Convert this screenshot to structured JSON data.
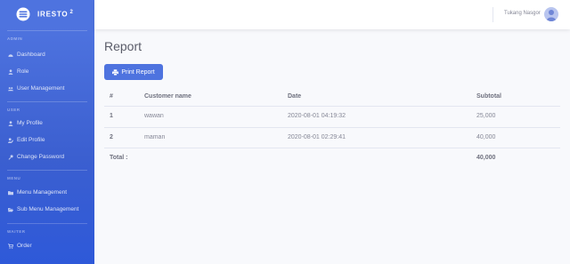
{
  "brand": {
    "name": "IRESTO",
    "sup": "2"
  },
  "sidebar": {
    "sections": [
      {
        "heading": "ADMIN",
        "items": [
          {
            "label": "Dashboard",
            "icon": "dashboard-icon"
          },
          {
            "label": "Role",
            "icon": "user-icon"
          },
          {
            "label": "User Management",
            "icon": "users-icon"
          }
        ]
      },
      {
        "heading": "USER",
        "items": [
          {
            "label": "My Profile",
            "icon": "user-icon"
          },
          {
            "label": "Edit Profile",
            "icon": "user-edit-icon"
          },
          {
            "label": "Change Password",
            "icon": "key-icon"
          }
        ]
      },
      {
        "heading": "MENU",
        "items": [
          {
            "label": "Menu Management",
            "icon": "folder-icon"
          },
          {
            "label": "Sub Menu Management",
            "icon": "folder-open-icon"
          }
        ]
      },
      {
        "heading": "WAITER",
        "items": [
          {
            "label": "Order",
            "icon": "cart-icon"
          }
        ]
      }
    ]
  },
  "topbar": {
    "user_name": "Tukang Nasgor"
  },
  "main": {
    "title": "Report",
    "print_label": "Print Report",
    "table": {
      "headers": [
        "#",
        "Customer name",
        "Date",
        "Subtotal"
      ],
      "rows": [
        [
          "1",
          "wawan",
          "2020-08-01 04:19:32",
          "25,000"
        ],
        [
          "2",
          "maman",
          "2020-08-01 02:29:41",
          "40,000"
        ]
      ],
      "total_label": "Total :",
      "total_value": "40,000"
    }
  },
  "colors": {
    "primary": "#4e73df",
    "sidebar_bottom": "#2e59d9",
    "text": "#858796"
  }
}
